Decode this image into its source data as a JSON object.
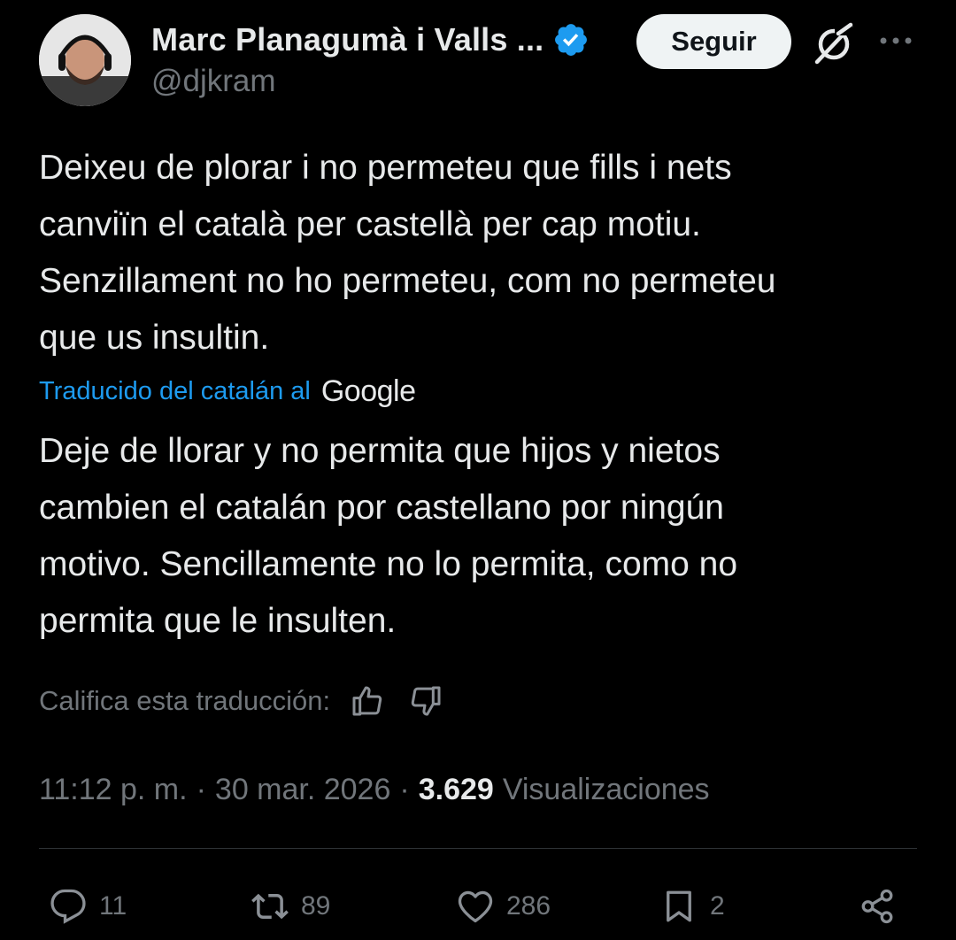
{
  "author": {
    "display_name": "Marc Planagumà i Valls ...",
    "handle": "@djkram",
    "verified_icon": "verified-badge-icon",
    "accent_color": "#1d9bf0"
  },
  "header": {
    "follow_label": "Seguir",
    "grok_icon": "grok-icon",
    "more_icon": "more-options-icon"
  },
  "tweet": {
    "text": "Deixeu de plorar i no permeteu que fills i nets\ncanviïn el català per castellà per cap motiu.\nSenzillament no ho permeteu, com no permeteu\nque us insultin."
  },
  "translation": {
    "label": "Traducido del catalán al",
    "provider": "Google",
    "text": "Deje de llorar y no permita que hijos y nietos\ncambien el catalán por castellano por ningún\nmotivo. Sencillamente no lo permita, como no\npermita que le insulten.",
    "rate_label": "Califica esta traducción:"
  },
  "meta": {
    "time": "11:12 p. m.",
    "separator": "·",
    "date": "30 mar. 2026",
    "views_count": "3.629",
    "views_label": "Visualizaciones"
  },
  "actions": {
    "replies": "11",
    "reposts": "89",
    "likes": "286",
    "bookmarks": "2"
  }
}
